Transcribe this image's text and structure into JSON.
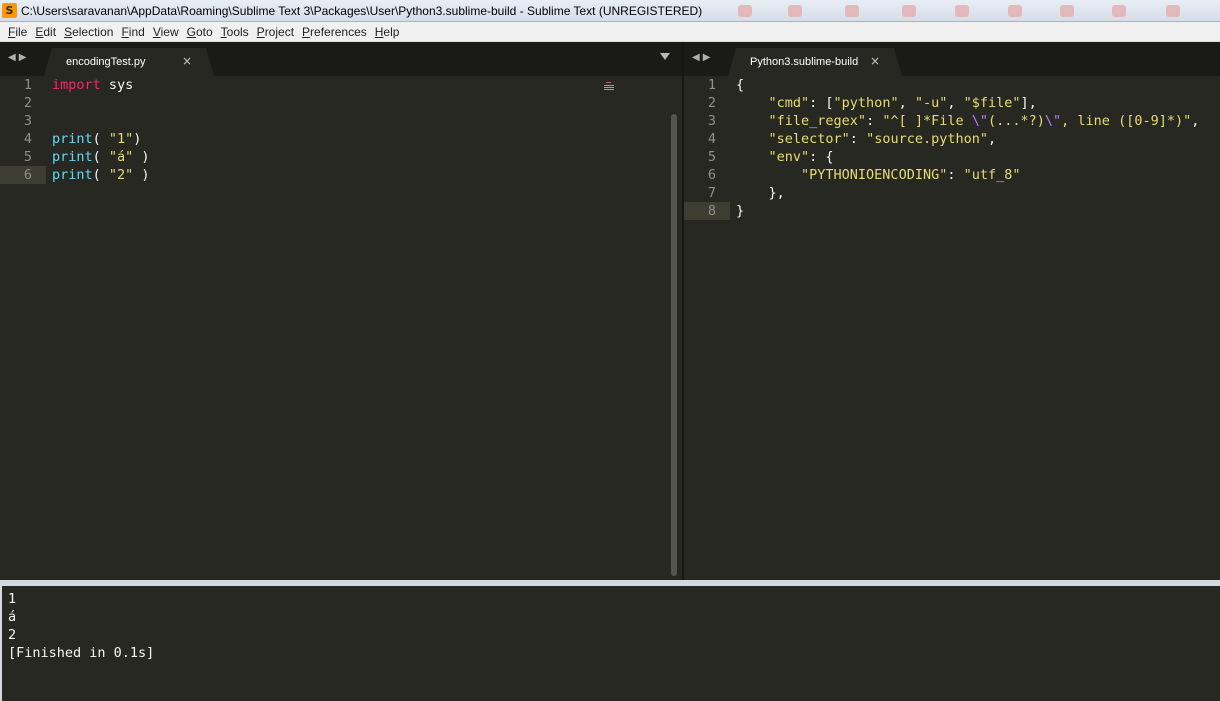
{
  "window": {
    "title": "C:\\Users\\saravanan\\AppData\\Roaming\\Sublime Text 3\\Packages\\User\\Python3.sublime-build - Sublime Text (UNREGISTERED)"
  },
  "menu": [
    "File",
    "Edit",
    "Selection",
    "Find",
    "View",
    "Goto",
    "Tools",
    "Project",
    "Preferences",
    "Help"
  ],
  "left_pane": {
    "tab_label": "encodingTest.py",
    "close_glyph": "×",
    "line_numbers": [
      "1",
      "2",
      "3",
      "4",
      "5",
      "6"
    ],
    "lines": [
      {
        "keyword": "import",
        "rest": " sys"
      },
      {
        "text": ""
      },
      {
        "text": ""
      },
      {
        "fn": "print",
        "pre": "( ",
        "str": "\"1\"",
        "post": ")"
      },
      {
        "fn": "print",
        "pre": "( ",
        "str": "\"á\"",
        "post": " )"
      },
      {
        "fn": "print",
        "pre": "( ",
        "str": "\"2\"",
        "post": " )"
      }
    ],
    "current_line": 6
  },
  "right_pane": {
    "tab_label": "Python3.sublime-build",
    "close_glyph": "×",
    "line_numbers": [
      "1",
      "2",
      "3",
      "4",
      "5",
      "6",
      "7",
      "8"
    ],
    "lines": [
      "{",
      "    \"cmd\": [\"python\", \"-u\", \"$file\"],",
      "    \"file_regex\": \"^[ ]*File \\\"(...*?)\\\", line ([0-9]*)\",",
      "    \"selector\": \"source.python\",",
      "    \"env\": {",
      "        \"PYTHONIOENCODING\": \"utf_8\"",
      "    },",
      "}"
    ],
    "current_line": 8
  },
  "output": {
    "lines": [
      "1",
      "á",
      "2",
      "[Finished in 0.1s]"
    ]
  },
  "colors": {
    "background": "#272822",
    "keyword": "#f92672",
    "function": "#66d9ef",
    "string": "#e6db74",
    "escape": "#ae81ff",
    "foreground": "#f8f8f2",
    "app_icon": "#ff9800"
  },
  "icons": [
    "sublime-logo-icon",
    "nav-left-icon",
    "nav-right-icon",
    "close-icon",
    "dropdown-icon"
  ]
}
